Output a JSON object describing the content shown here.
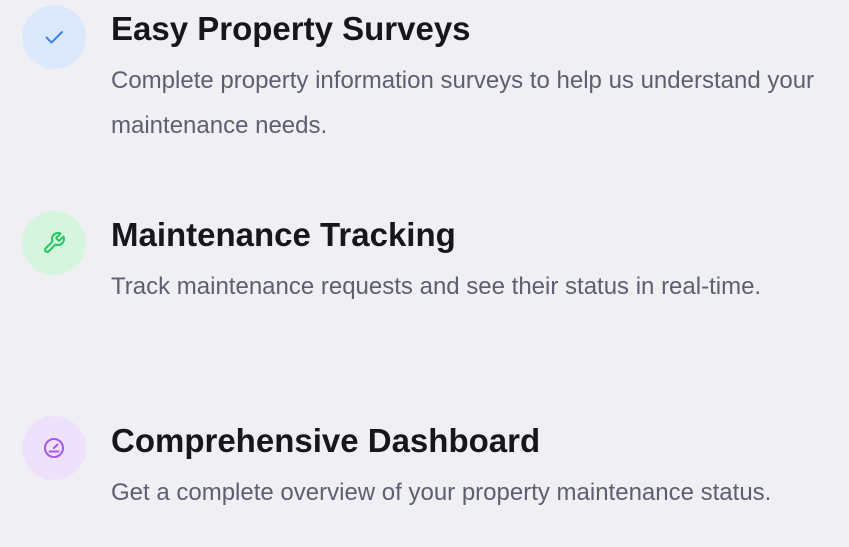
{
  "features": [
    {
      "title": "Easy Property Surveys",
      "description": "Complete property information surveys to help us understand your maintenance needs.",
      "icon": "check-icon",
      "icon_bg": "#dce8fb",
      "icon_color": "#3b82f6"
    },
    {
      "title": "Maintenance Tracking",
      "description": "Track maintenance requests and see their status in real-time.",
      "icon": "wrench-icon",
      "icon_bg": "#d6f5de",
      "icon_color": "#22c55e"
    },
    {
      "title": "Comprehensive Dashboard",
      "description": "Get a complete overview of your property maintenance status.",
      "icon": "gauge-icon",
      "icon_bg": "#ede1fb",
      "icon_color": "#a855f7"
    }
  ]
}
